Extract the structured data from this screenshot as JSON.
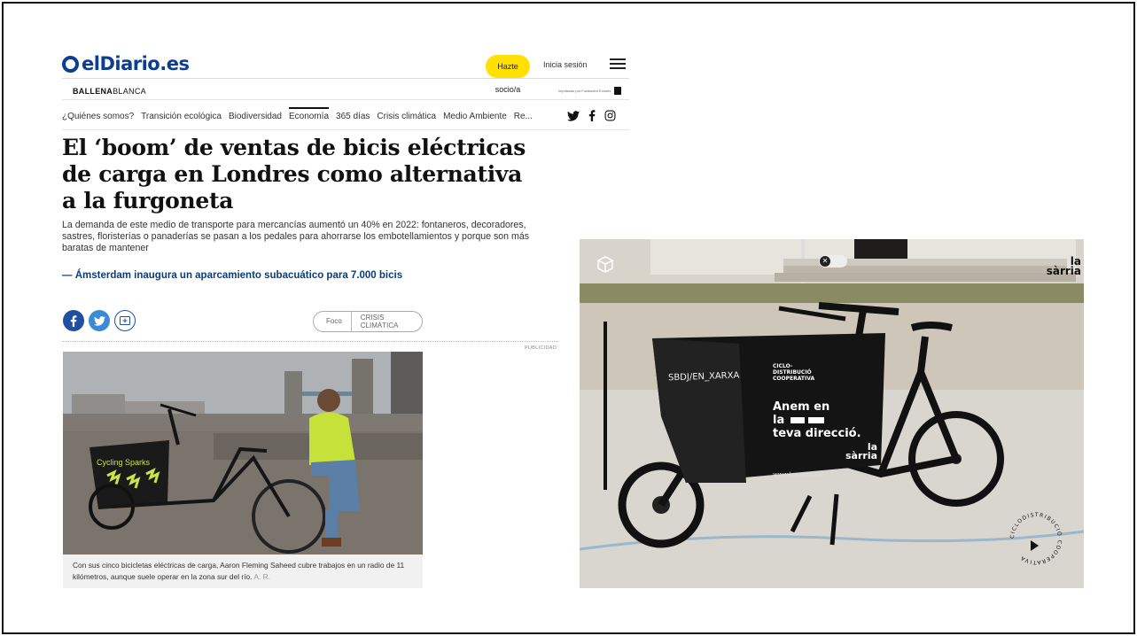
{
  "header": {
    "logo": "elDiario.es",
    "subscribe_label": "Hazte socio/a",
    "login_label": "Inicia sesión",
    "section_brand_bold": "BALLENA",
    "section_brand_light": "BLANCA",
    "sponsor_text": "impulsado por Fundación Ecodes"
  },
  "nav": {
    "items": [
      "¿Quiénes somos?",
      "Transición ecológica",
      "Biodiversidad",
      "Economía",
      "365 días",
      "Crisis climática",
      "Medio Ambiente",
      "Re..."
    ],
    "active_index": 3
  },
  "article": {
    "headline": "El ‘boom’ de ventas de bicis eléctricas de carga en Londres como alternativa a la furgoneta",
    "lead": "La demanda de este medio de transporte para mercancías aumentó un 40% en 2022: fontaneros, decoradores, sastres, floristerías o panaderías se pasan a los pedales para ahorrarse los embotellamientos y porque son más baratas de mantener",
    "related": "— Ámsterdam inaugura un aparcamiento subacuático para 7.000 bicis",
    "focus_label": "Foco",
    "focus_tag": "CRISIS CLIMÁTICA",
    "ad_label": "PUBLICIDAD",
    "photo_sign": "Cycling Sparks",
    "caption": "Con sus cinco bicicletas eléctricas de carga, Aaron Fleming Saheed cubre trabajos en un radio de 11 kilómetros, aunque suele operar en la zona sur del río.",
    "credit": "A. R."
  },
  "ad": {
    "brand": [
      "la",
      "sàrria"
    ],
    "box_tag": "SBDJ/EN_XARXA",
    "box_small": [
      "CICLO-",
      "DISTRIBUCIÓ",
      "COOPERATIVA"
    ],
    "box_slogan": [
      "Anem en",
      "la",
      "teva direcció."
    ],
    "box_url": "www.lasarria.cat",
    "badge_text": "CICLODISTRIBUCIÓ COOPERATIVA",
    "progress": 0.48
  },
  "colors": {
    "brand_blue": "#0b3d91",
    "subscribe_yellow": "#ffe000",
    "facebook": "#1e4fa0",
    "twitter": "#3a8ad6"
  }
}
